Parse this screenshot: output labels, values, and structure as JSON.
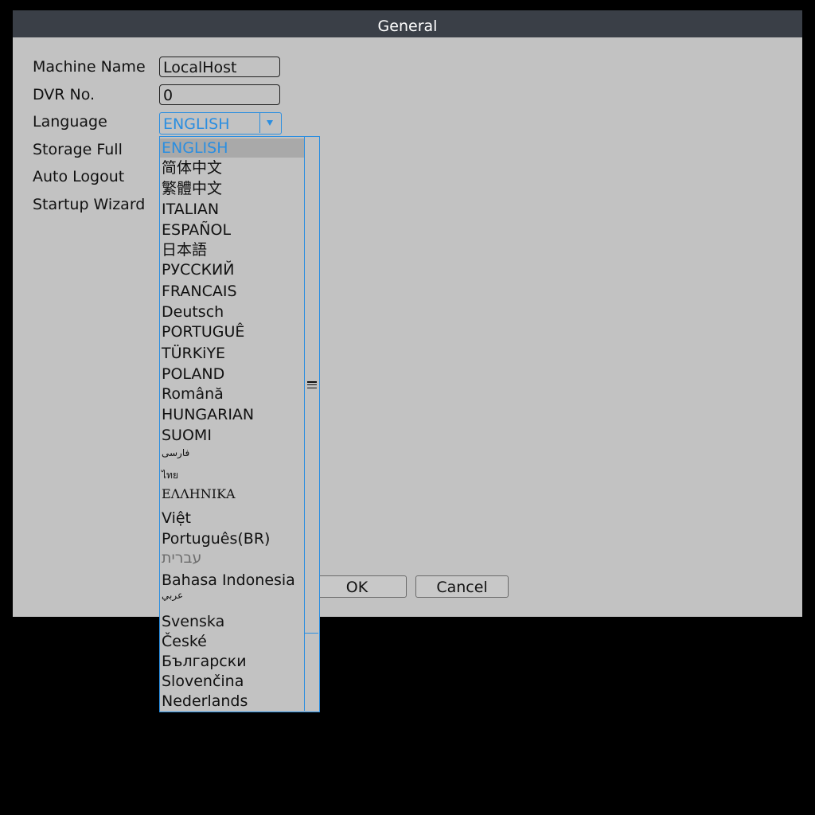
{
  "dialog": {
    "title": "General"
  },
  "form": {
    "machine_name": {
      "label": "Machine Name",
      "value": "LocalHost"
    },
    "dvr_no": {
      "label": "DVR No.",
      "value": "0"
    },
    "language": {
      "label": "Language",
      "value": "ENGLISH"
    },
    "storage_full": {
      "label": "Storage Full"
    },
    "auto_logout": {
      "label": "Auto Logout"
    },
    "startup_wizard": {
      "label": "Startup Wizard"
    }
  },
  "buttons": {
    "ok": "OK",
    "cancel": "Cancel"
  },
  "language_options": [
    "ENGLISH",
    "简体中文",
    "繁體中文",
    "ITALIAN",
    "ESPAÑOL",
    "日本語",
    "РУССКИЙ",
    "FRANCAIS",
    "Deutsch",
    "PORTUGUÊ",
    "TÜRKiYE",
    "POLAND",
    "Română",
    "HUNGARIAN",
    "SUOMI",
    "فارسی",
    "ไทย",
    "ΕΛΛΗΝΙΚΑ",
    "Việt",
    "Português(BR)",
    "עברית",
    "Bahasa Indonesia",
    "عربي",
    "Svenska",
    "České",
    "Български",
    "Slovenčina",
    "Nederlands"
  ],
  "colors": {
    "accent": "#2b8ee0",
    "dialog_bg": "#c2c2c2",
    "titlebar_bg": "#3a3f47",
    "screen_bg": "#000000"
  },
  "icons": {
    "dropdown_arrow": "chevron-down-icon",
    "scroll_grip": "grip-lines-icon"
  }
}
